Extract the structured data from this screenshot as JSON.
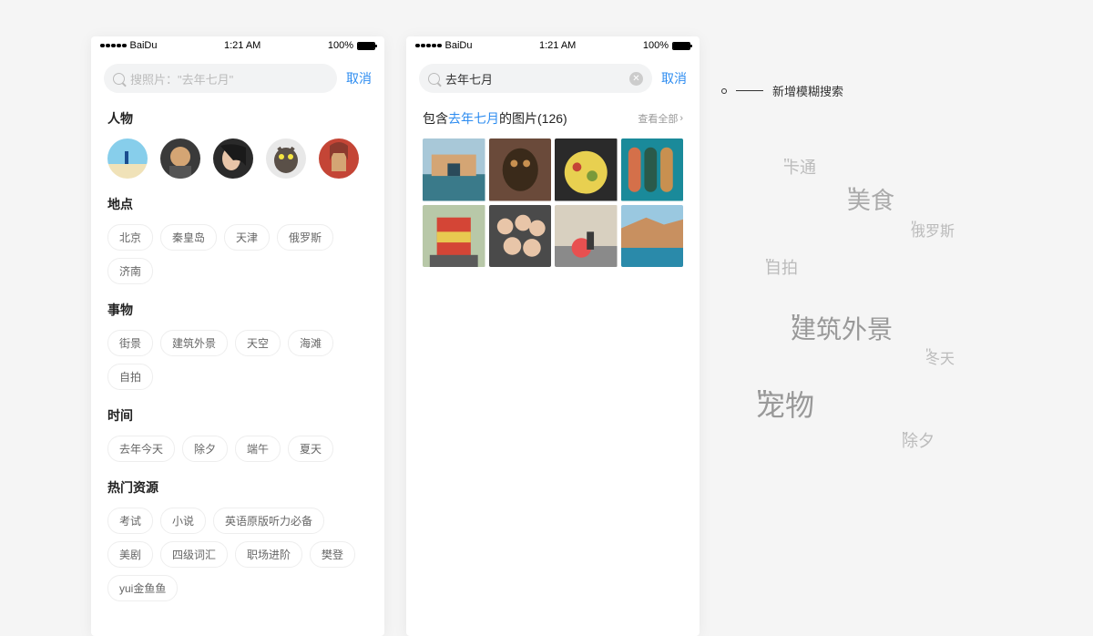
{
  "status": {
    "carrier": "BaiDu",
    "time": "1:21 AM",
    "battery": "100%"
  },
  "screen1": {
    "search_placeholder": "搜照片：\"去年七月\"",
    "cancel": "取消",
    "sections": {
      "people": "人物",
      "places": "地点",
      "things": "事物",
      "time": "时间",
      "hot": "热门资源"
    },
    "places": [
      "北京",
      "秦皇岛",
      "天津",
      "俄罗斯",
      "济南"
    ],
    "things": [
      "街景",
      "建筑外景",
      "天空",
      "海滩",
      "自拍"
    ],
    "time": [
      "去年今天",
      "除夕",
      "端午",
      "夏天"
    ],
    "hot": [
      "考试",
      "小说",
      "英语原版听力必备",
      "美剧",
      "四级词汇",
      "职场进阶",
      "樊登",
      "yui金鱼鱼"
    ]
  },
  "screen2": {
    "search_value": "去年七月",
    "cancel": "取消",
    "result_prefix": "包含",
    "result_highlight": "去年七月",
    "result_suffix": "的图片(126)",
    "view_all": "查看全部"
  },
  "callout": "新增模糊搜索",
  "cloud": [
    "卡通",
    "美食",
    "俄罗斯",
    "自拍",
    "建筑外景",
    "冬天",
    "宠物",
    "除夕"
  ],
  "colors": {
    "accent": "#2d8cf0"
  }
}
